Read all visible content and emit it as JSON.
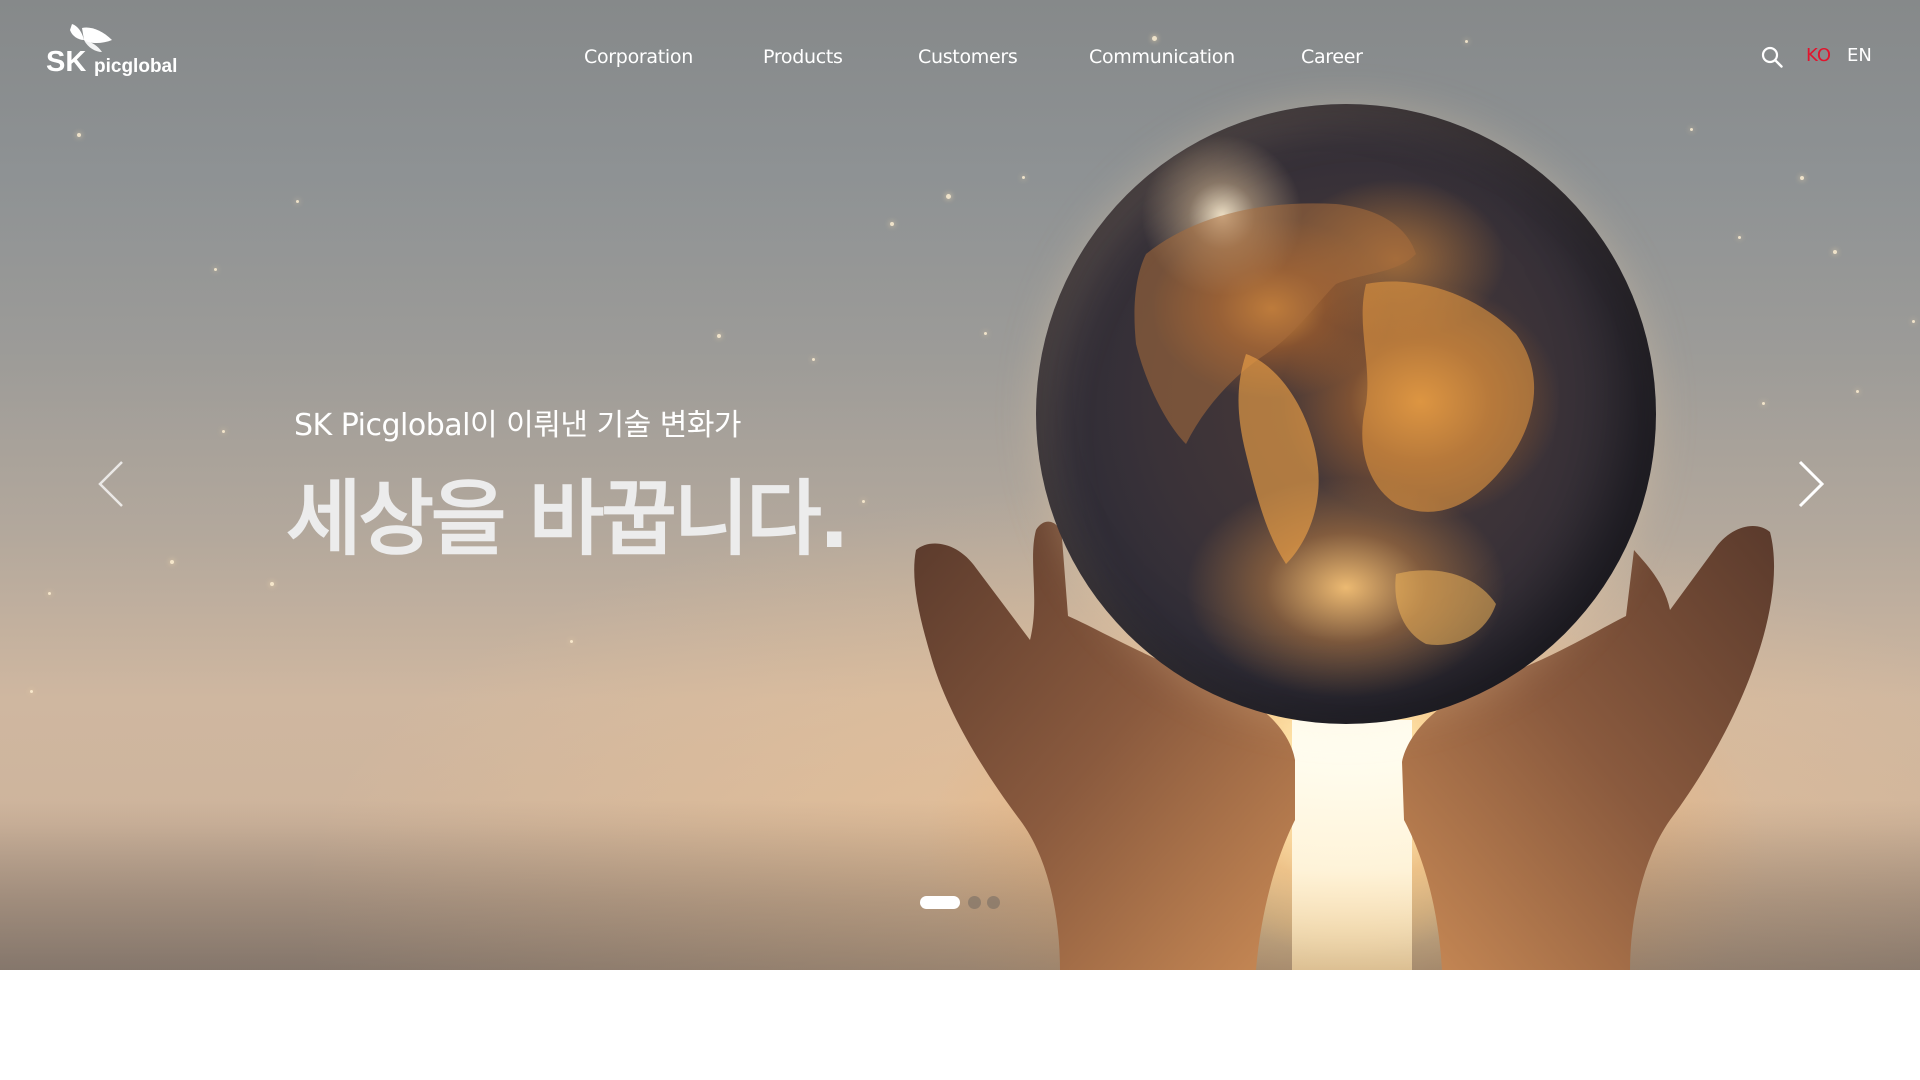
{
  "header": {
    "logo": {
      "brand": "SK",
      "name": "picglobal"
    },
    "nav": {
      "items": [
        {
          "label": "Corporation"
        },
        {
          "label": "Products"
        },
        {
          "label": "Customers"
        },
        {
          "label": "Communication"
        },
        {
          "label": "Career"
        }
      ]
    },
    "search_icon": "search-icon",
    "languages": {
      "ko": "KO",
      "en": "EN",
      "active": "KO",
      "active_color": "#e2142d"
    }
  },
  "hero": {
    "subtitle": "SK Picglobal이 이뤄낸 기술 변화가",
    "headline": "세상을 바꿉니다.",
    "prev_icon": "chevron-left-icon",
    "next_icon": "chevron-right-icon",
    "pagination": {
      "count": 3,
      "active_index": 0
    }
  },
  "colors": {
    "nav_text": "#ffffff",
    "lang_active": "#e2142d",
    "lang_inactive": "#ffffff"
  }
}
